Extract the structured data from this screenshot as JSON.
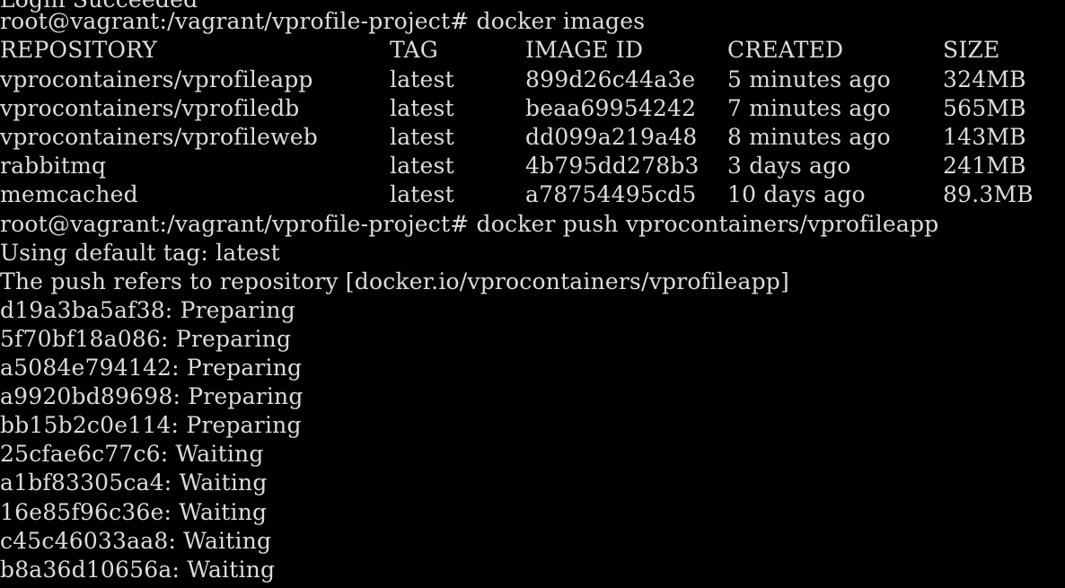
{
  "terminal": {
    "partial_top_line": "Login Succeeded",
    "prompt1": "root@vagrant:/vagrant/vprofile-project# docker images",
    "headers": {
      "repository": "REPOSITORY",
      "tag": "TAG",
      "image_id": "IMAGE ID",
      "created": "CREATED",
      "size": "SIZE"
    },
    "images": [
      {
        "repository": "vprocontainers/vprofileapp",
        "tag": "latest",
        "image_id": "899d26c44a3e",
        "created": "5 minutes ago",
        "size": "324MB"
      },
      {
        "repository": "vprocontainers/vprofiledb",
        "tag": "latest",
        "image_id": "beaa69954242",
        "created": "7 minutes ago",
        "size": "565MB"
      },
      {
        "repository": "vprocontainers/vprofileweb",
        "tag": "latest",
        "image_id": "dd099a219a48",
        "created": "8 minutes ago",
        "size": "143MB"
      },
      {
        "repository": "rabbitmq",
        "tag": "latest",
        "image_id": "4b795dd278b3",
        "created": "3 days ago",
        "size": "241MB"
      },
      {
        "repository": "memcached",
        "tag": "latest",
        "image_id": "a78754495cd5",
        "created": "10 days ago",
        "size": "89.3MB"
      }
    ],
    "prompt2": "root@vagrant:/vagrant/vprofile-project# docker push vprocontainers/vprofileapp",
    "push_lines": [
      "Using default tag: latest",
      "The push refers to repository [docker.io/vprocontainers/vprofileapp]",
      "d19a3ba5af38: Preparing",
      "5f70bf18a086: Preparing",
      "a5084e794142: Preparing",
      "a9920bd89698: Preparing",
      "bb15b2c0e114: Preparing",
      "25cfae6c77c6: Waiting",
      "a1bf83305ca4: Waiting",
      "16e85f96c36e: Waiting",
      "c45c46033aa8: Waiting",
      "b8a36d10656a: Waiting"
    ]
  },
  "colors": {
    "background": "#000000",
    "text": "#dcdcdc"
  }
}
